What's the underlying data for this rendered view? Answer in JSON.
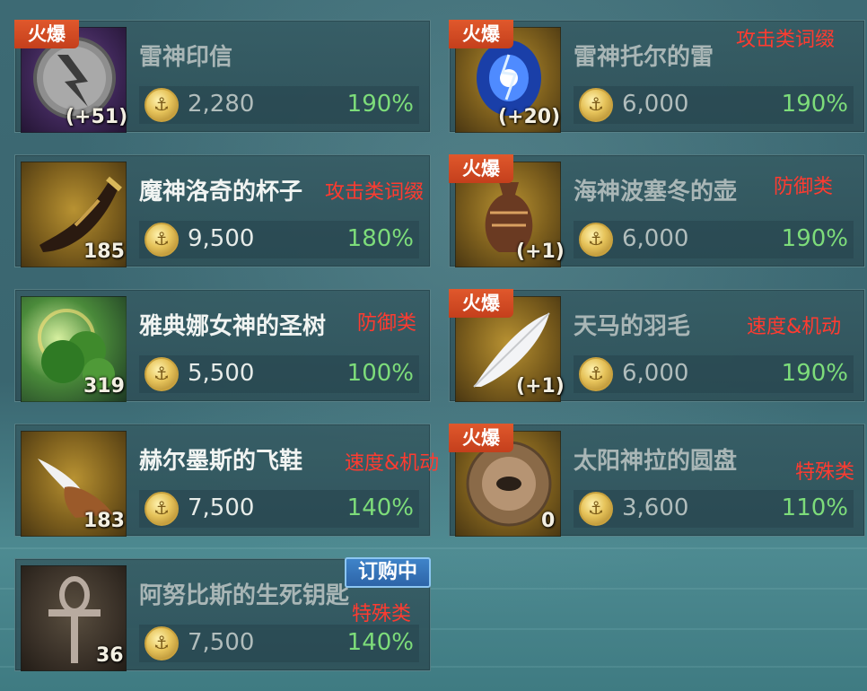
{
  "items": [
    {
      "id": "leishen-yinxin",
      "name": "雷神印信",
      "price": "2,280",
      "pct": "190%",
      "qty": "(+51)",
      "hot": "火爆",
      "tag": "",
      "dim": true
    },
    {
      "id": "leishen-tuoer",
      "name": "雷神托尔的雷",
      "price": "6,000",
      "pct": "190%",
      "qty": "(+20)",
      "hot": "火爆",
      "tag": "攻击类词缀",
      "dim": true
    },
    {
      "id": "moshen-luoqi",
      "name": "魔神洛奇的杯子",
      "price": "9,500",
      "pct": "180%",
      "qty": "185",
      "hot": "",
      "tag": "攻击类词缀",
      "dim": false
    },
    {
      "id": "haishen-bosaidong",
      "name": "海神波塞冬的壶",
      "price": "6,000",
      "pct": "190%",
      "qty": "(+1)",
      "hot": "火爆",
      "tag": "防御类",
      "dim": true
    },
    {
      "id": "yadiana-shengshu",
      "name": "雅典娜女神的圣树",
      "price": "5,500",
      "pct": "100%",
      "qty": "319",
      "hot": "",
      "tag": "防御类",
      "dim": false
    },
    {
      "id": "tianma-yumao",
      "name": "天马的羽毛",
      "price": "6,000",
      "pct": "190%",
      "qty": "(+1)",
      "hot": "火爆",
      "tag": "速度&机动",
      "dim": true
    },
    {
      "id": "heermosi-feixie",
      "name": "赫尔墨斯的飞鞋",
      "price": "7,500",
      "pct": "140%",
      "qty": "183",
      "hot": "",
      "tag": "速度&机动",
      "dim": false
    },
    {
      "id": "taiyangshen-yuanpan",
      "name": "太阳神拉的圆盘",
      "price": "3,600",
      "pct": "110%",
      "qty": "0",
      "hot": "火爆",
      "tag": "特殊类",
      "dim": true
    },
    {
      "id": "anubisi-yaoshi",
      "name": "阿努比斯的生死钥匙",
      "price": "7,500",
      "pct": "140%",
      "qty": "36",
      "hot": "",
      "tag": "特殊类",
      "dim": true,
      "badge": "订购中"
    }
  ],
  "colors": {
    "hot_badge": "#d94b23",
    "pct_green": "#7ddc7a",
    "tag_red": "#ff3b30",
    "subscribe_blue": "#2d64a8"
  },
  "icons": {
    "coin": "anchor-coin-icon"
  }
}
